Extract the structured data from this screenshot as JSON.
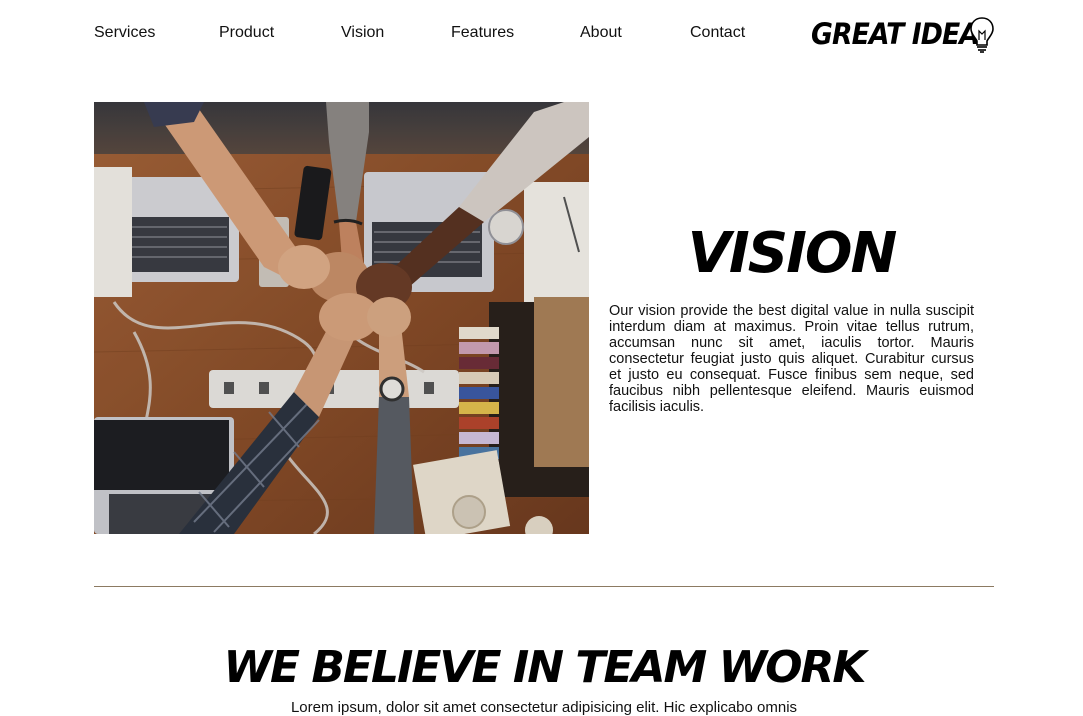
{
  "nav": {
    "items": [
      {
        "label": "Services"
      },
      {
        "label": "Product"
      },
      {
        "label": "Vision"
      },
      {
        "label": "Features"
      },
      {
        "label": "About"
      },
      {
        "label": "Contact"
      }
    ]
  },
  "logo": {
    "text": "GREAT IDEA",
    "icon": "lightbulb-icon"
  },
  "hero": {
    "image": "team-fist-bump-photo"
  },
  "vision": {
    "heading": "VISION",
    "body": "Our vision provide the best digital value in nulla suscipit interdum diam at maximus. Proin vitae tellus rutrum, accumsan nunc sit amet, iaculis tortor. Mauris consectetur feugiat justo quis aliquet. Curabitur cursus et justo eu consequat. Fusce finibus sem neque, sed faucibus nibh pellentesque eleifend. Mauris euismod facilisis iaculis."
  },
  "team": {
    "heading": "WE BELIEVE IN TEAM WORK",
    "body": "Lorem ipsum, dolor sit amet consectetur adipisicing elit. Hic explicabo omnis"
  },
  "colors": {
    "divider": "#8c7a62",
    "background": "#ffffff",
    "text": "#111111"
  }
}
